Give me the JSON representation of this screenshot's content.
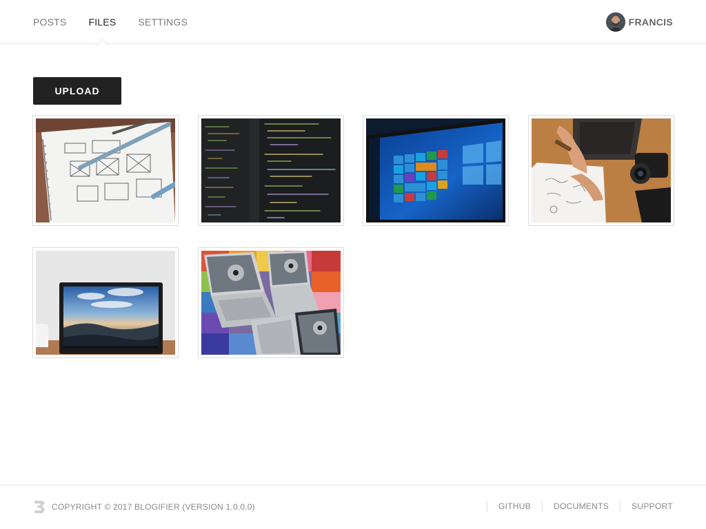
{
  "nav": {
    "items": [
      {
        "label": "POSTS",
        "active": false
      },
      {
        "label": "FILES",
        "active": true
      },
      {
        "label": "SETTINGS",
        "active": false
      }
    ]
  },
  "user": {
    "name": "FRANCIS",
    "avatar_icon": "user-avatar"
  },
  "toolbar": {
    "upload_label": "UPLOAD"
  },
  "gallery": {
    "images": [
      {
        "name": "wireframe-sketch-image"
      },
      {
        "name": "code-editor-image"
      },
      {
        "name": "windows-tablet-image"
      },
      {
        "name": "desk-notebook-camera-image"
      },
      {
        "name": "laptop-landscape-wallpaper-image"
      },
      {
        "name": "surface-laptops-image"
      }
    ]
  },
  "footer": {
    "logo_icon": "blogifier-logo-icon",
    "copyright": "COPYRIGHT © 2017 BLOGIFIER (VERSION 1.0.0.0)",
    "links": [
      "GITHUB",
      "DOCUMENTS",
      "SUPPORT"
    ]
  },
  "colors": {
    "button_bg": "#222222",
    "nav_active": "#222222",
    "nav_inactive": "#7a7a7a",
    "border": "#e6e6e6"
  }
}
